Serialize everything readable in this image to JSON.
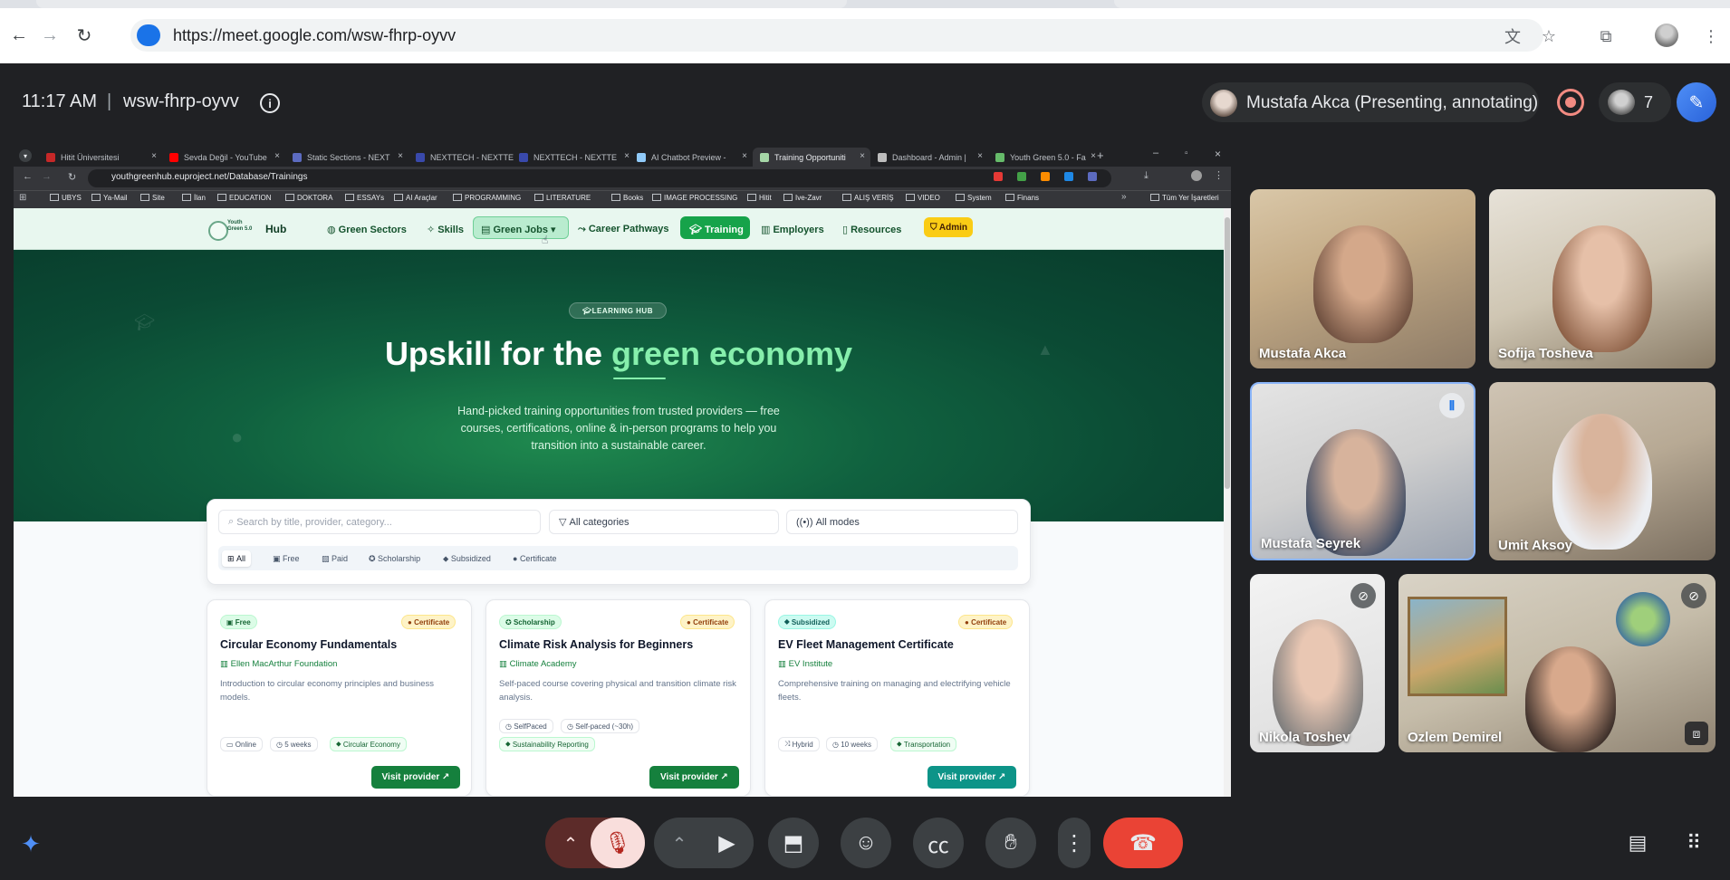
{
  "browser": {
    "url": "https://meet.google.com/wsw-fhrp-oyvv"
  },
  "meet": {
    "time": "11:17 AM",
    "separator": "|",
    "code": "wsw-fhrp-oyvv",
    "presenter_label": "Mustafa Akca (Presenting, annotating)",
    "participant_count": "7"
  },
  "shared": {
    "tabs": [
      {
        "label": "Hitit Üniversitesi",
        "color": "#c62828"
      },
      {
        "label": "Sevda Değil - YouTube",
        "color": "#ff0000"
      },
      {
        "label": "Static Sections - NEXT",
        "color": "#5c6bc0"
      },
      {
        "label": "NEXTTECH - NEXTTE",
        "color": "#3949ab"
      },
      {
        "label": "NEXTTECH - NEXTTE",
        "color": "#3949ab"
      },
      {
        "label": "AI Chatbot Preview -",
        "color": "#90caf9"
      },
      {
        "label": "Training Opportuniti",
        "color": "#a5d6a7"
      },
      {
        "label": "Dashboard - Admin |",
        "color": "#bdbdbd"
      },
      {
        "label": "Youth Green 5.0 - Fa",
        "color": "#66bb6a"
      }
    ],
    "url": "youthgreenhub.euproject.net/Database/Trainings",
    "bookmarks": [
      "UBYS",
      "Ya-Mail",
      "Site",
      "İlan",
      "EDUCATION",
      "DOKTORA",
      "ESSAYs",
      "AI Araçlar",
      "PROGRAMMING",
      "LITERATURE",
      "Books",
      "IMAGE PROCESSING",
      "Hitit",
      "Ive-Zavr",
      "ALIŞ VERİŞ",
      "VIDEO",
      "System",
      "Finans",
      "Tüm Yer İşaretleri"
    ]
  },
  "site": {
    "logo_text": "Youth Green 5.0",
    "hub": "Hub",
    "nav": {
      "green_sectors": "Green Sectors",
      "skills": "Skills",
      "green_jobs": "Green Jobs",
      "career_pathways": "Career Pathways",
      "training": "Training",
      "employers": "Employers",
      "resources": "Resources",
      "admin": "Admin"
    },
    "hero": {
      "badge": "LEARNING HUB",
      "title_a": "Upskill for the ",
      "title_b": "green economy",
      "desc": "Hand-picked training opportunities from trusted providers — free courses, certifications, online & in-person programs to help you transition into a sustainable career."
    },
    "filters": {
      "search_placeholder": "Search by title, provider, category...",
      "category": "All categories",
      "mode": "All modes",
      "chips": [
        "All",
        "Free",
        "Paid",
        "Scholarship",
        "Subsidized",
        "Certificate"
      ]
    },
    "cards": [
      {
        "badge": "Free",
        "cert": "Certificate",
        "title": "Circular Economy Fundamentals",
        "provider": "Ellen MacArthur Foundation",
        "desc": "Introduction to circular economy principles and business models.",
        "tags": [
          "Online",
          "5 weeks",
          "Circular Economy"
        ],
        "cta": "Visit provider"
      },
      {
        "badge": "Scholarship",
        "cert": "Certificate",
        "title": "Climate Risk Analysis for Beginners",
        "provider": "Climate Academy",
        "desc": "Self-paced course covering physical and transition climate risk analysis.",
        "tags": [
          "SelfPaced",
          "Self-paced (~30h)",
          "Sustainability Reporting"
        ],
        "cta": "Visit provider"
      },
      {
        "badge": "Subsidized",
        "cert": "Certificate",
        "title": "EV Fleet Management Certificate",
        "provider": "EV Institute",
        "desc": "Comprehensive training on managing and electrifying vehicle fleets.",
        "tags": [
          "Hybrid",
          "10 weeks",
          "Transportation"
        ],
        "cta": "Visit provider"
      }
    ]
  },
  "participants": [
    {
      "name": "Mustafa Akca"
    },
    {
      "name": "Sofija Tosheva"
    },
    {
      "name": "Mustafa Seyrek"
    },
    {
      "name": "Umit Aksoy"
    },
    {
      "name": "Nikola Toshev"
    },
    {
      "name": "Ozlem Demirel"
    }
  ],
  "colors": {
    "meet_bg": "#202124",
    "accent_green": "#16a34a",
    "end_call_red": "#ea4335",
    "mic_off_bg": "#f9dedc"
  }
}
